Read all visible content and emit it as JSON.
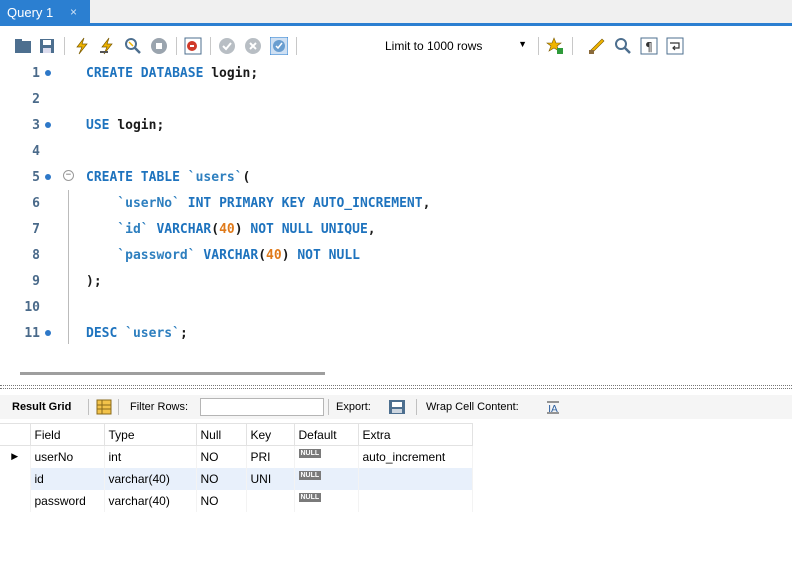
{
  "tab": {
    "title": "Query 1",
    "close": "×"
  },
  "toolbar": {
    "limit_label": "Limit to 1000 rows",
    "icons": [
      "open-folder-icon",
      "save-icon",
      "execute-icon",
      "execute-statement-icon",
      "explain-icon",
      "stop-icon",
      "toggle-error-icon",
      "commit-icon",
      "rollback-icon",
      "autocommit-icon",
      "add-snippet-icon",
      "beautify-icon",
      "find-icon",
      "invisible-chars-icon",
      "word-wrap-icon"
    ]
  },
  "editor": {
    "lines": [
      {
        "no": "1",
        "marker": true,
        "tokens": [
          [
            "kw",
            "CREATE DATABASE "
          ],
          [
            "id",
            "login;"
          ]
        ]
      },
      {
        "no": "2",
        "marker": false,
        "tokens": []
      },
      {
        "no": "3",
        "marker": true,
        "tokens": [
          [
            "kw",
            "USE "
          ],
          [
            "id",
            "login;"
          ]
        ]
      },
      {
        "no": "4",
        "marker": false,
        "tokens": []
      },
      {
        "no": "5",
        "marker": true,
        "fold": true,
        "tokens": [
          [
            "kw",
            "CREATE TABLE "
          ],
          [
            "str",
            "`users`"
          ],
          [
            "id",
            "("
          ]
        ]
      },
      {
        "no": "6",
        "marker": false,
        "tokens": [
          [
            "id",
            "    "
          ],
          [
            "str",
            "`userNo`"
          ],
          [
            "kw",
            " INT PRIMARY KEY AUTO_INCREMENT"
          ],
          [
            "id",
            ","
          ]
        ]
      },
      {
        "no": "7",
        "marker": false,
        "tokens": [
          [
            "id",
            "    "
          ],
          [
            "str",
            "`id`"
          ],
          [
            "kw",
            " VARCHAR"
          ],
          [
            "id",
            "("
          ],
          [
            "num",
            "40"
          ],
          [
            "id",
            ")"
          ],
          [
            "kw",
            " NOT NULL UNIQUE"
          ],
          [
            "id",
            ","
          ]
        ]
      },
      {
        "no": "8",
        "marker": false,
        "tokens": [
          [
            "id",
            "    "
          ],
          [
            "str",
            "`password`"
          ],
          [
            "kw",
            " VARCHAR"
          ],
          [
            "id",
            "("
          ],
          [
            "num",
            "40"
          ],
          [
            "id",
            ")"
          ],
          [
            "kw",
            " NOT NULL"
          ]
        ]
      },
      {
        "no": "9",
        "marker": false,
        "tokens": [
          [
            "id",
            ");"
          ]
        ]
      },
      {
        "no": "10",
        "marker": false,
        "tokens": []
      },
      {
        "no": "11",
        "marker": true,
        "tokens": [
          [
            "kw",
            "DESC "
          ],
          [
            "str",
            "`users`"
          ],
          [
            "id",
            ";"
          ]
        ]
      }
    ]
  },
  "result_bar": {
    "result_grid": "Result Grid",
    "filter_rows": "Filter Rows:",
    "export": "Export:",
    "wrap_cell": "Wrap Cell Content:"
  },
  "grid": {
    "columns": [
      "Field",
      "Type",
      "Null",
      "Key",
      "Default",
      "Extra"
    ],
    "rows": [
      {
        "Field": "userNo",
        "Type": "int",
        "Null": "NO",
        "Key": "PRI",
        "Default": "NULL",
        "Extra": "auto_increment"
      },
      {
        "Field": "id",
        "Type": "varchar(40)",
        "Null": "NO",
        "Key": "UNI",
        "Default": "NULL",
        "Extra": ""
      },
      {
        "Field": "password",
        "Type": "varchar(40)",
        "Null": "NO",
        "Key": "",
        "Default": "NULL",
        "Extra": ""
      }
    ],
    "selected_row_marker": "▶"
  },
  "colors": {
    "accent": "#2b7fd1",
    "keyword": "#1e73be",
    "number": "#e07a1a",
    "alt_row": "#e8f0fb"
  }
}
